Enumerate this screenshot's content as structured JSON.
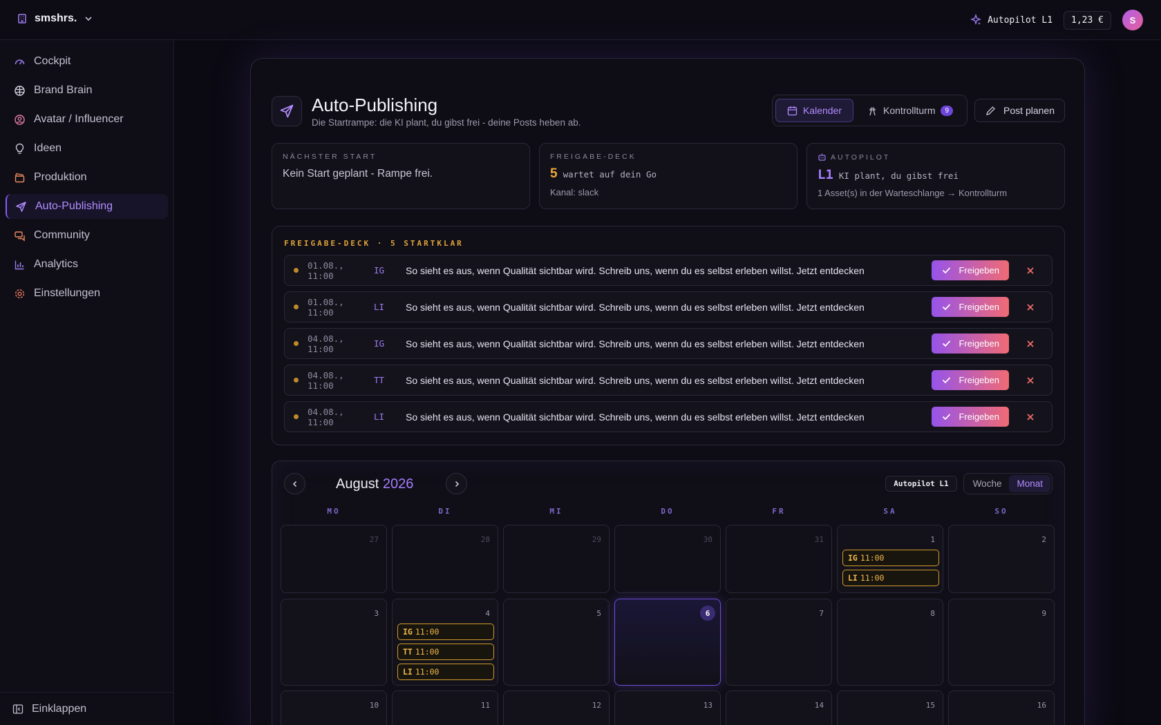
{
  "topbar": {
    "workspace": "smshrs.",
    "autopilot": "Autopilot L1",
    "credits": "1,23 €",
    "avatar_initial": "S"
  },
  "sidebar": {
    "items": [
      {
        "label": "Cockpit",
        "icon": "gauge-icon"
      },
      {
        "label": "Brand Brain",
        "icon": "brain-icon"
      },
      {
        "label": "Avatar / Influencer",
        "icon": "user-circle-icon"
      },
      {
        "label": "Ideen",
        "icon": "lightbulb-icon"
      },
      {
        "label": "Produktion",
        "icon": "clapperboard-icon"
      },
      {
        "label": "Auto-Publishing",
        "icon": "send-icon"
      },
      {
        "label": "Community",
        "icon": "chat-icon"
      },
      {
        "label": "Analytics",
        "icon": "bar-chart-icon"
      },
      {
        "label": "Einstellungen",
        "icon": "gear-icon"
      }
    ],
    "active_index": 5,
    "collapse_label": "Einklappen"
  },
  "page": {
    "title": "Auto-Publishing",
    "subtitle": "Die Startrampe: die KI plant, du gibst frei - deine Posts heben ab.",
    "tabs": {
      "calendar": "Kalender",
      "control": "Kontrollturm",
      "control_badge": "9"
    },
    "plan_button": "Post planen"
  },
  "cards": {
    "next": {
      "label": "NÄCHSTER START",
      "text": "Kein Start geplant - Rampe frei."
    },
    "deck": {
      "label": "FREIGABE-DECK",
      "count": "5",
      "count_text": "wartet auf dein Go",
      "foot": "Kanal: slack"
    },
    "autopilot": {
      "label": "AUTOPILOT",
      "level": "L1",
      "level_text": "KI plant, du gibst frei",
      "foot": "1 Asset(s) in der Warteschlange → Kontrollturm"
    }
  },
  "deck": {
    "title": "FREIGABE-DECK · 5 STARTKLAR",
    "approve_label": "Freigeben",
    "rows": [
      {
        "date": "01.08., 11:00",
        "channel": "IG",
        "text": "So sieht es aus, wenn Qualität sichtbar wird. Schreib uns, wenn du es selbst erleben willst. Jetzt entdecken"
      },
      {
        "date": "01.08., 11:00",
        "channel": "LI",
        "text": "So sieht es aus, wenn Qualität sichtbar wird. Schreib uns, wenn du es selbst erleben willst. Jetzt entdecken"
      },
      {
        "date": "04.08., 11:00",
        "channel": "IG",
        "text": "So sieht es aus, wenn Qualität sichtbar wird. Schreib uns, wenn du es selbst erleben willst. Jetzt entdecken"
      },
      {
        "date": "04.08., 11:00",
        "channel": "TT",
        "text": "So sieht es aus, wenn Qualität sichtbar wird. Schreib uns, wenn du es selbst erleben willst. Jetzt entdecken"
      },
      {
        "date": "04.08., 11:00",
        "channel": "LI",
        "text": "So sieht es aus, wenn Qualität sichtbar wird. Schreib uns, wenn du es selbst erleben willst. Jetzt entdecken"
      }
    ]
  },
  "calendar": {
    "month": "August",
    "year": "2026",
    "autopilot_pill": "Autopilot L1",
    "view_week": "Woche",
    "view_month": "Monat",
    "weekdays": [
      "MO",
      "DI",
      "MI",
      "DO",
      "FR",
      "SA",
      "SO"
    ],
    "weeks": [
      [
        {
          "day": "27",
          "muted": true,
          "events": []
        },
        {
          "day": "28",
          "muted": true,
          "events": []
        },
        {
          "day": "29",
          "muted": true,
          "events": []
        },
        {
          "day": "30",
          "muted": true,
          "events": []
        },
        {
          "day": "31",
          "muted": true,
          "events": []
        },
        {
          "day": "1",
          "events": [
            {
              "ch": "IG",
              "time": "11:00"
            },
            {
              "ch": "LI",
              "time": "11:00"
            }
          ]
        },
        {
          "day": "2",
          "events": []
        }
      ],
      [
        {
          "day": "3",
          "events": []
        },
        {
          "day": "4",
          "events": [
            {
              "ch": "IG",
              "time": "11:00"
            },
            {
              "ch": "TT",
              "time": "11:00"
            },
            {
              "ch": "LI",
              "time": "11:00"
            }
          ]
        },
        {
          "day": "5",
          "events": []
        },
        {
          "day": "6",
          "today": true,
          "events": []
        },
        {
          "day": "7",
          "events": []
        },
        {
          "day": "8",
          "events": []
        },
        {
          "day": "9",
          "events": []
        }
      ],
      [
        {
          "day": "10",
          "events": []
        },
        {
          "day": "11",
          "events": []
        },
        {
          "day": "12",
          "events": []
        },
        {
          "day": "13",
          "events": []
        },
        {
          "day": "14",
          "events": []
        },
        {
          "day": "15",
          "events": []
        },
        {
          "day": "16",
          "events": []
        }
      ]
    ]
  },
  "colors": {
    "accent": "#8b5cf6",
    "warning": "#f0a83a",
    "reject": "#f26b6b"
  }
}
